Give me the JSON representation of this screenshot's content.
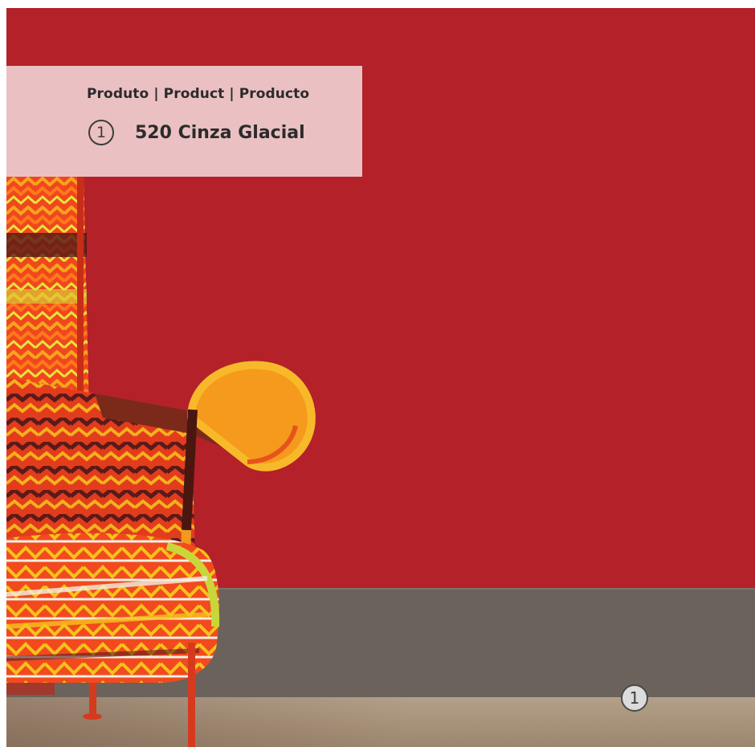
{
  "label_panel": {
    "heading": "Produto | Product | Producto",
    "item_number": "1",
    "product_name": "520 Cinza Glacial"
  },
  "photo": {
    "wall_marker": "1",
    "colors": {
      "wall": "#b42129",
      "baseboard": "#6b625c",
      "floor": "#a69078",
      "panel": "#ebc0c3"
    }
  }
}
